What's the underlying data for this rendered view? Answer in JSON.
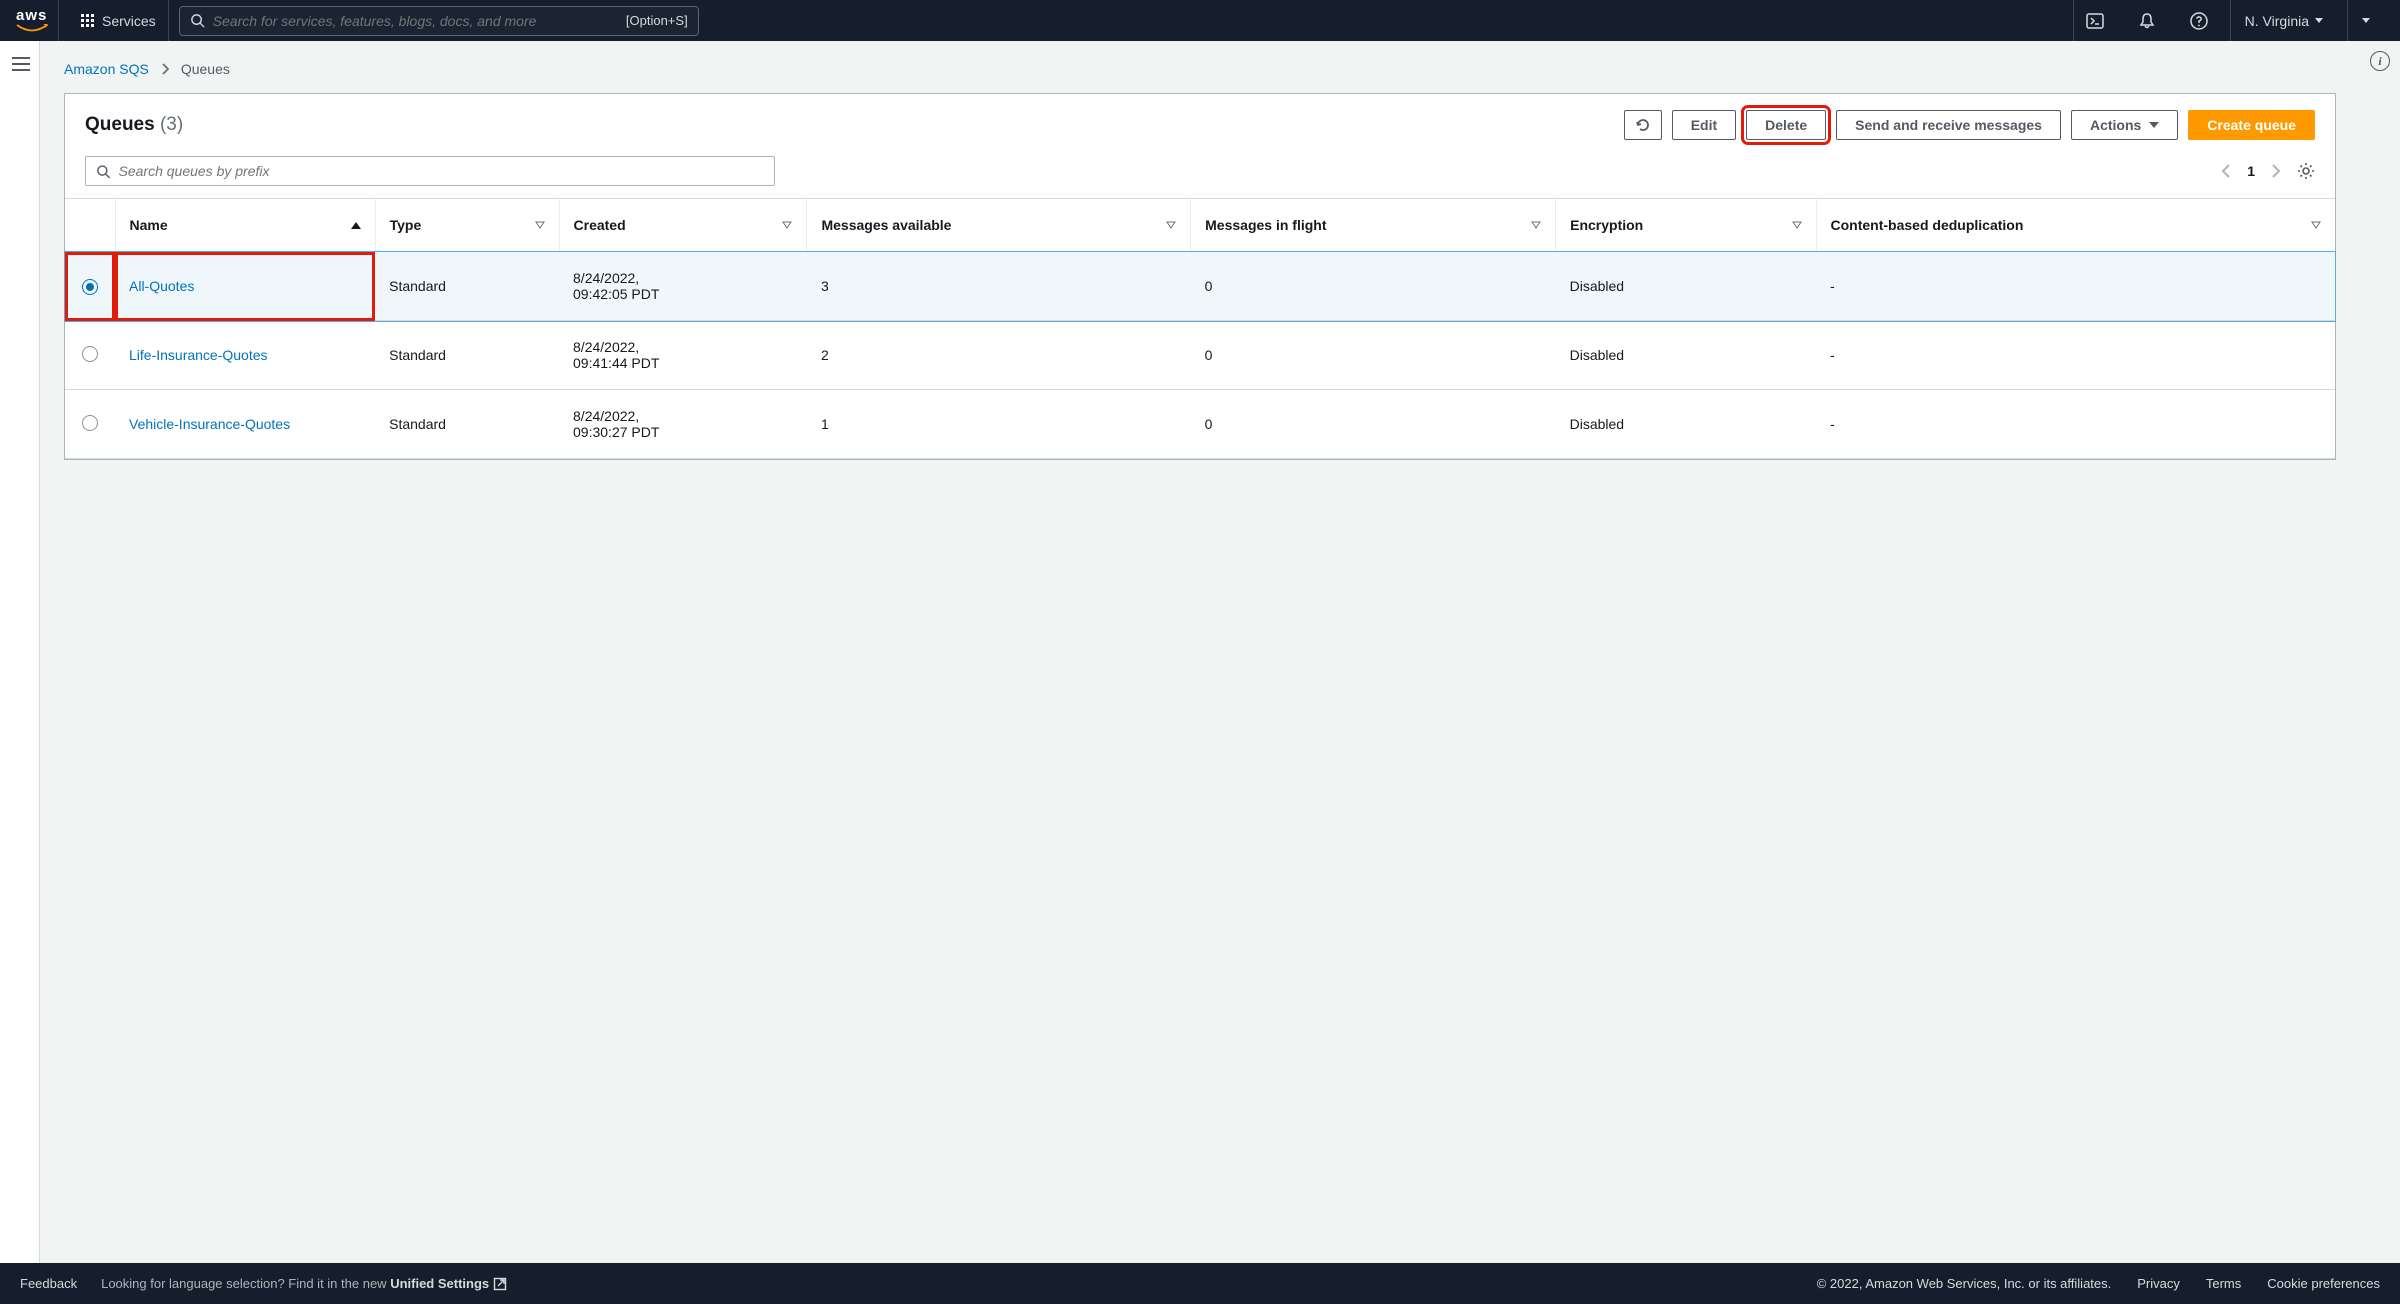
{
  "topnav": {
    "services": "Services",
    "search_placeholder": "Search for services, features, blogs, docs, and more",
    "search_hint": "[Option+S]",
    "region": "N. Virginia"
  },
  "breadcrumb": {
    "root": "Amazon SQS",
    "current": "Queues"
  },
  "panel": {
    "title": "Queues",
    "count": "(3)",
    "buttons": {
      "edit": "Edit",
      "delete": "Delete",
      "send_receive": "Send and receive messages",
      "actions": "Actions",
      "create": "Create queue"
    },
    "search_placeholder": "Search queues by prefix",
    "page": "1"
  },
  "table": {
    "columns": {
      "name": "Name",
      "type": "Type",
      "created": "Created",
      "available": "Messages available",
      "inflight": "Messages in flight",
      "encryption": "Encryption",
      "dedup": "Content-based deduplication"
    },
    "rows": [
      {
        "selected": true,
        "name": "All-Quotes",
        "type": "Standard",
        "created": "8/24/2022, 09:42:05 PDT",
        "available": "3",
        "inflight": "0",
        "encryption": "Disabled",
        "dedup": "-",
        "highlight": true
      },
      {
        "selected": false,
        "name": "Life-Insurance-Quotes",
        "type": "Standard",
        "created": "8/24/2022, 09:41:44 PDT",
        "available": "2",
        "inflight": "0",
        "encryption": "Disabled",
        "dedup": "-"
      },
      {
        "selected": false,
        "name": "Vehicle-Insurance-Quotes",
        "type": "Standard",
        "created": "8/24/2022, 09:30:27 PDT",
        "available": "1",
        "inflight": "0",
        "encryption": "Disabled",
        "dedup": "-"
      }
    ]
  },
  "footer": {
    "feedback": "Feedback",
    "lang_msg": "Looking for language selection? Find it in the new ",
    "unified": "Unified Settings",
    "copyright": "© 2022, Amazon Web Services, Inc. or its affiliates.",
    "privacy": "Privacy",
    "terms": "Terms",
    "cookies": "Cookie preferences"
  }
}
